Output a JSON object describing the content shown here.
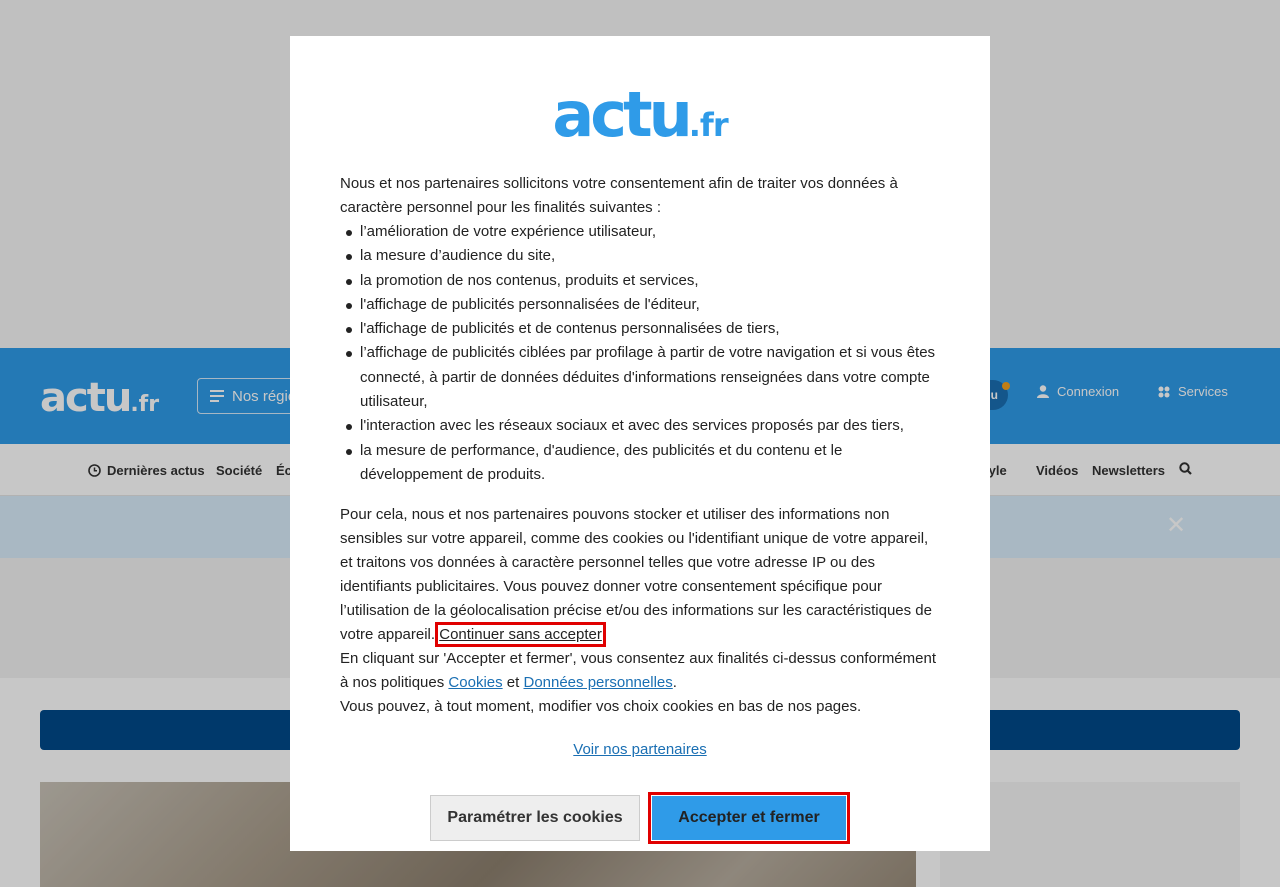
{
  "header": {
    "logo_main": "actu",
    "logo_suffix": ".fr",
    "regions_label": "Nos régions",
    "menu_label": "Menu",
    "login_label": "Connexion",
    "services_label": "Services"
  },
  "nav": {
    "items": [
      "Dernières actus",
      "Société",
      "Économie",
      "Lifestyle",
      "Vidéos",
      "Newsletters"
    ]
  },
  "consent": {
    "logo_main": "actu",
    "logo_suffix": ".fr",
    "intro": "Nous et nos partenaires sollicitons votre consentement afin de traiter vos données à caractère personnel pour les finalités suivantes :",
    "purposes": [
      "l’amélioration de votre expérience utilisateur,",
      "la mesure d’audience du site,",
      "la promotion de nos contenus, produits et services,",
      "l'affichage de publicités personnalisées de l'éditeur,",
      "l'affichage de publicités et de contenus personnalisées de tiers,",
      "l’affichage de publicités ciblées par profilage à partir de votre navigation et si vous êtes connecté, à partir de données déduites d'informations renseignées dans votre compte utilisateur,",
      "l'interaction avec les réseaux sociaux et avec des services proposés par des tiers,",
      "la mesure de performance, d'audience, des publicités et du contenu et le développement de produits."
    ],
    "storage_text": "Pour cela, nous et nos partenaires pouvons stocker et utiliser des informations non sensibles sur votre appareil, comme des cookies ou l'identifiant unique de votre appareil, et traitons vos données à caractère personnel telles que votre adresse IP ou des identifiants publicitaires. Vous pouvez donner votre consentement spécifique pour l’utilisation de la géolocalisation précise et/ou des informations sur les caractéristiques de votre appareil.",
    "continue_link": "Continuer sans accepter",
    "accept_text_before": "En cliquant sur 'Accepter et fermer', vous consentez aux finalités ci-dessus conformément à nos politiques",
    "cookies_link": "Cookies",
    "and_word": "et",
    "personal_data_link": "Données personnelles",
    "period": ".",
    "modify_text": "Vous pouvez, à tout moment, modifier vos choix cookies en bas de nos pages.",
    "partners_link": "Voir nos partenaires",
    "settings_button": "Paramétrer les cookies",
    "accept_button": "Accepter et fermer"
  },
  "colors": {
    "brand_blue": "#2f9be8",
    "dark_blue": "#004a8a",
    "highlight_red": "#e00000"
  }
}
